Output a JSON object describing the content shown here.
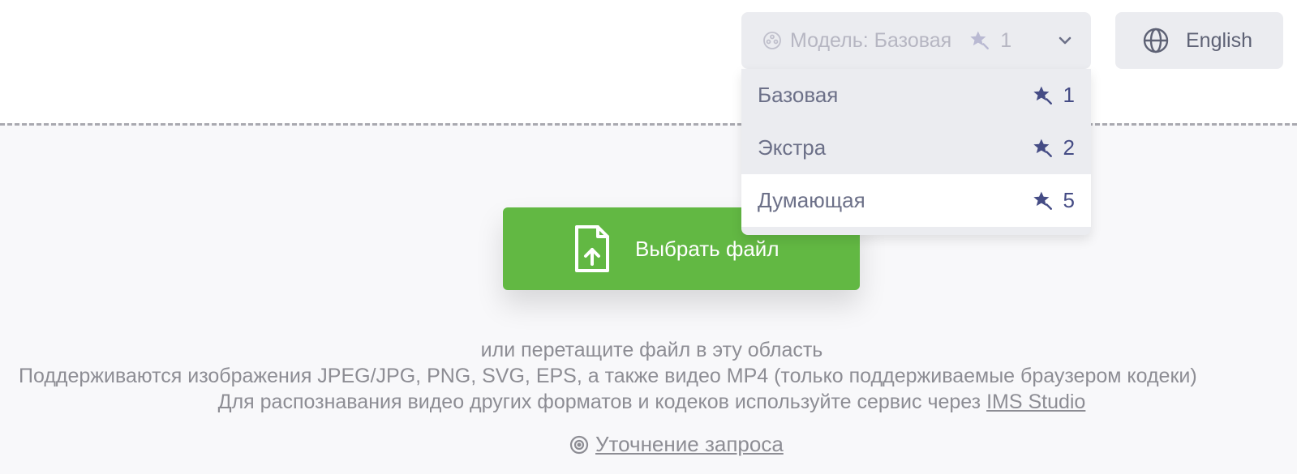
{
  "header": {
    "model_select": {
      "label": "Модель: Базовая",
      "cost": "1",
      "icon": "model-icon",
      "chevron": "chevron-down-icon"
    },
    "language": {
      "label": "English",
      "icon": "globe-icon"
    }
  },
  "model_menu": {
    "items": [
      {
        "label": "Базовая",
        "cost": "1",
        "icon": "star-icon"
      },
      {
        "label": "Экстра",
        "cost": "2",
        "icon": "star-icon"
      },
      {
        "label": "Думающая",
        "cost": "5",
        "icon": "star-icon",
        "active": true
      }
    ]
  },
  "upload": {
    "button_label": "Выбрать файл",
    "icon": "file-upload-icon",
    "drop_hint": "или перетащите файл в эту область",
    "supported_formats": "Поддерживаются изображения JPEG/JPG, PNG, SVG, EPS, а также видео MP4 (только поддерживаемые браузером кодеки)",
    "other_formats_text": "Для распознавания видео других форматов и кодеков используйте сервис через ",
    "other_formats_link": "IMS Studio",
    "refine_link": "Уточнение запроса",
    "refine_icon": "target-icon"
  },
  "colors": {
    "primary_green": "#62b843",
    "accent_indigo": "#454c85",
    "control_bg": "#ebecf0",
    "dropzone_bg": "#f8f8fa"
  }
}
